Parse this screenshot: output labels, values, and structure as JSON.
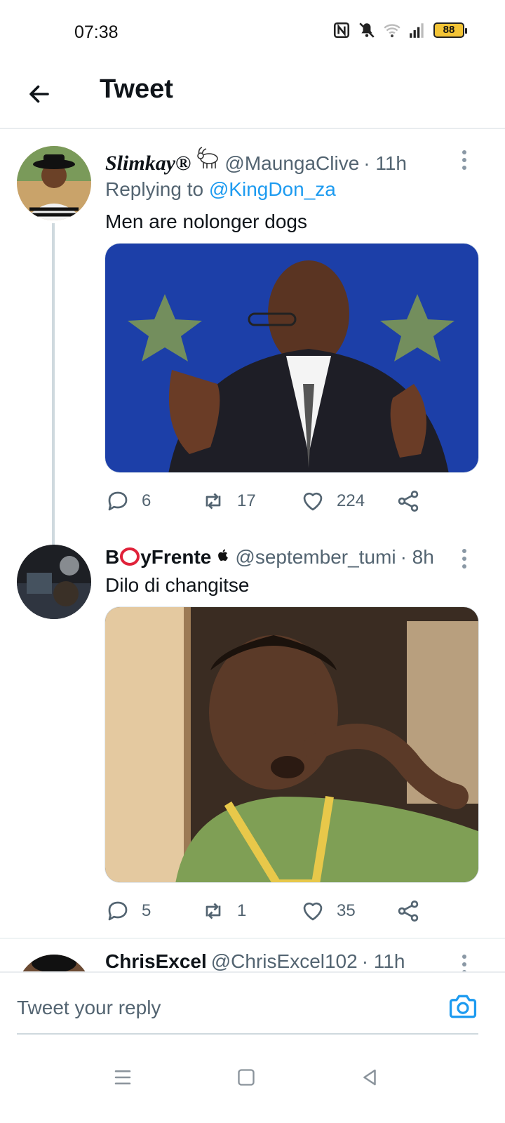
{
  "status_bar": {
    "time": "07:38",
    "battery": "88",
    "icons": [
      "nfc-icon",
      "silent-icon",
      "wifi-icon",
      "signal-icon",
      "battery-icon"
    ]
  },
  "header": {
    "title": "Tweet",
    "back_icon": "arrow-left-icon"
  },
  "tweets": [
    {
      "display_name": "Slimkay®",
      "name_icon": "goat-emoji",
      "handle": "@MaungaClive",
      "time": "· 11h",
      "replying_prefix": "Replying to",
      "replying_to": "@KingDon_za",
      "text": "Men are nolonger dogs",
      "media_description": "photo",
      "replies": "6",
      "retweets": "17",
      "likes": "224"
    },
    {
      "display_name_part1": "B",
      "display_name_part2": "yFrente",
      "name_icon": "apple-icon",
      "handle": "@september_tumi",
      "time": "· 8h",
      "text": "Dilo di changitse",
      "media_description": "photo",
      "replies": "5",
      "retweets": "1",
      "likes": "35"
    },
    {
      "display_name": "ChrisExcel",
      "handle": "@ChrisExcel102",
      "time": "· 11h"
    }
  ],
  "reply_bar": {
    "placeholder": "Tweet your reply",
    "camera_icon": "camera-icon"
  },
  "nav_bar": {
    "icons": [
      "menu-icon",
      "home-square-icon",
      "back-triangle-icon"
    ]
  },
  "colors": {
    "accent": "#1d9bf0",
    "text": "#0f1419",
    "muted": "#536471"
  }
}
